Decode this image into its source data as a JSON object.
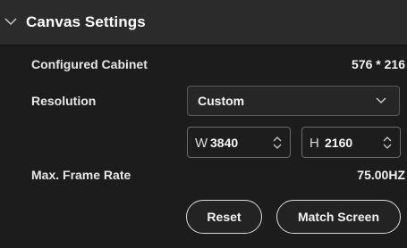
{
  "section": {
    "title": "Canvas Settings",
    "collapse_icon": "chevron-down-icon"
  },
  "configured_cabinet": {
    "label": "Configured Cabinet",
    "value": "576 * 216"
  },
  "resolution": {
    "label": "Resolution",
    "selected": "Custom",
    "caret_icon": "chevron-down-icon"
  },
  "width_field": {
    "prefix": "W",
    "value": "3840",
    "stepper_icon": "up-down-arrows-icon"
  },
  "height_field": {
    "prefix": "H",
    "value": "2160",
    "stepper_icon": "up-down-arrows-icon"
  },
  "frame_rate": {
    "label": "Max. Frame Rate",
    "value": "75.00HZ"
  },
  "buttons": {
    "reset": "Reset",
    "match_screen": "Match Screen"
  },
  "colors": {
    "header_bg": "#2b2b2b",
    "panel_bg": "#1c1c1c",
    "text": "#e8e8e8",
    "button_border": "#d9d9d9"
  }
}
